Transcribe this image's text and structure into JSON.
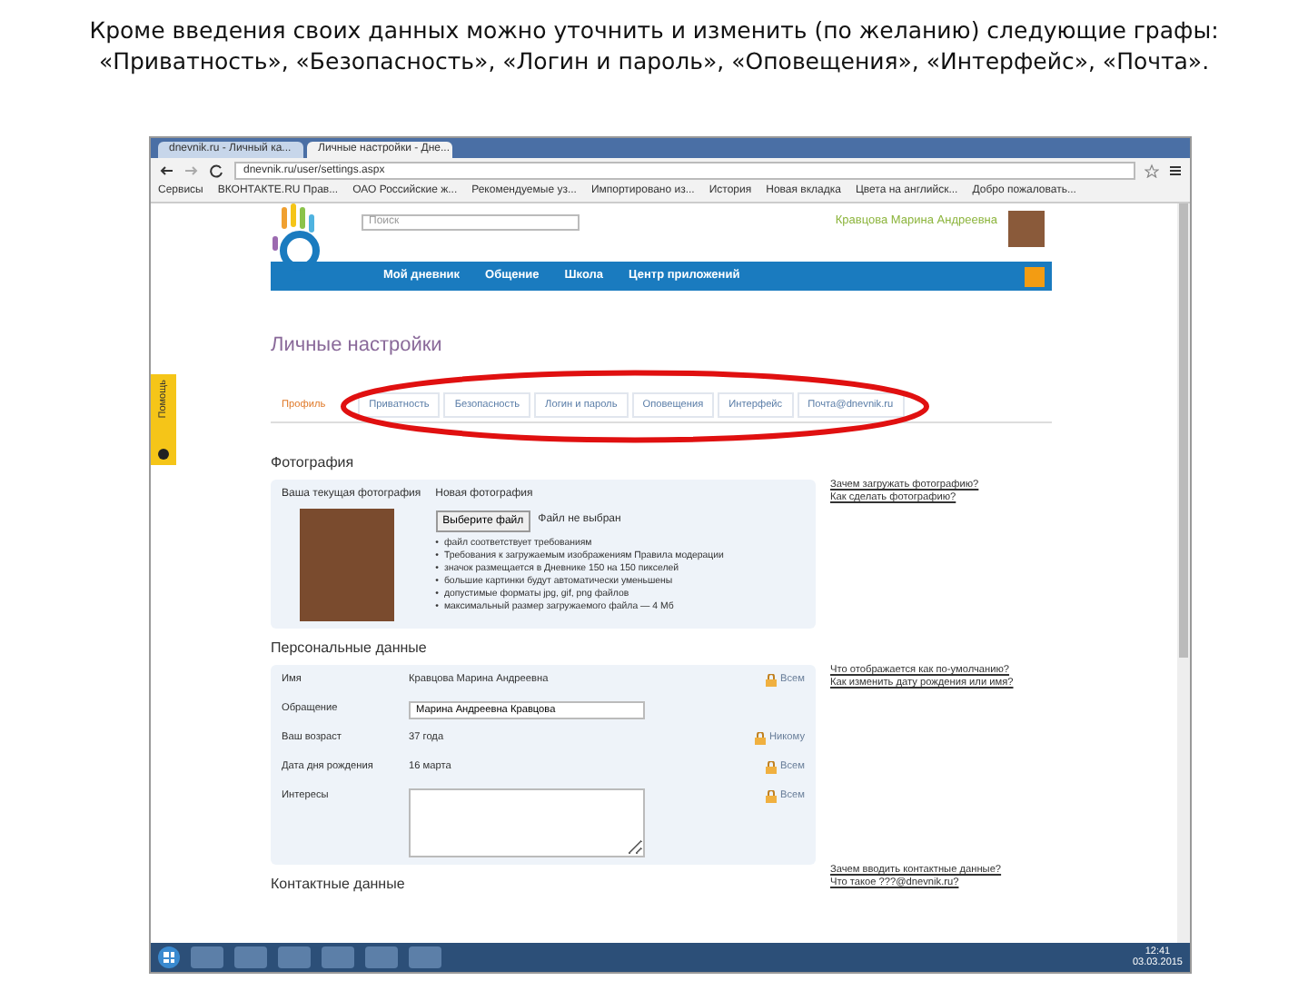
{
  "slide": {
    "title_lines": [
      "Кроме введения своих данных можно уточнить и изменить (по желанию) следующие графы:",
      "«Приватность», «Безопасность», «Логин и пароль», «Оповещения», «Интерфейс», «Почта»."
    ]
  },
  "browser": {
    "tabs": [
      {
        "label": "dnevnik.ru - Личный ка...",
        "selected": false
      },
      {
        "label": "Личные настройки - Дне...",
        "selected": true
      }
    ],
    "url": "dnevnik.ru/user/settings.aspx",
    "bookmarks": [
      "Сервисы",
      "ВКОНТАКТЕ.RU Прав...",
      "ОАО Российские ж...",
      "Рекомендуемые уз...",
      "Импортировано из...",
      "История",
      "Новая вкладка",
      "Цвета на английск...",
      "Добро пожаловать..."
    ]
  },
  "site": {
    "search": {
      "placeholder": "Поиск"
    },
    "user_name": "Кравцова Марина Андреевна",
    "nav": [
      "Мой дневник",
      "Общение",
      "Школа",
      "Центр приложений"
    ],
    "help_tab": "Помощь",
    "page_title": "Личные настройки",
    "tabs": [
      {
        "label": "Профиль",
        "selected": true
      },
      {
        "label": "Приватность",
        "selected": false
      },
      {
        "label": "Безопасность",
        "selected": false
      },
      {
        "label": "Логин и пароль",
        "selected": false
      },
      {
        "label": "Оповещения",
        "selected": false
      },
      {
        "label": "Интерфейс",
        "selected": false
      },
      {
        "label": "Почта@dnevnik.ru",
        "selected": false
      }
    ],
    "photo": {
      "heading": "Фотография",
      "current_label": "Ваша текущая фотография",
      "new_label": "Новая фотография",
      "file_button": "Выберите файл",
      "file_status": "Файл не выбран",
      "bullet": "•",
      "rules": [
        "файл соответствует требованиям",
        "Требования к загружаемым изображениям Правила модерации",
        "значок размещается в Дневнике 150 на 150 пикселей",
        "большие картинки будут автоматически уменьшены",
        "допустимые форматы jpg, gif, png файлов",
        "максимальный размер загружаемого файла — 4 Мб"
      ],
      "help_links": [
        "Зачем загружать фотографию?",
        "Как сделать фотографию?"
      ]
    },
    "personal": {
      "heading": "Персональные данные",
      "rows": [
        {
          "kind": "text",
          "label": "Имя",
          "value": "Кравцова Марина Андреевна",
          "visibility": "Всем"
        },
        {
          "kind": "input",
          "label": "Обращение",
          "value": "Марина Андреевна Кравцова"
        },
        {
          "kind": "text",
          "label": "Ваш возраст",
          "value": "37 года",
          "visibility": "Никому"
        },
        {
          "kind": "text",
          "label": "Дата дня рождения",
          "value": "16 марта",
          "visibility": "Всем"
        },
        {
          "kind": "textarea",
          "label": "Интересы",
          "value": "",
          "visibility": "Всем"
        }
      ],
      "help_links": [
        "Что отображается как по-умолчанию?",
        "Как изменить дату рождения или имя?"
      ]
    },
    "contacts": {
      "heading": "Контактные данные",
      "help_links": [
        "Зачем вводить контактные данные?",
        "Что такое ???@dnevnik.ru?"
      ]
    }
  },
  "taskbar": {
    "time": "12:41",
    "date": "03.03.2015"
  }
}
